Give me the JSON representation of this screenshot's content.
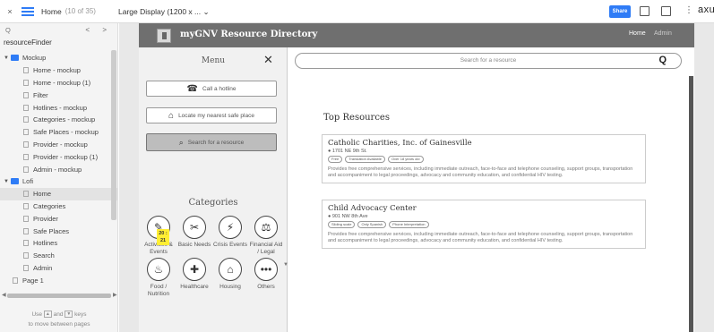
{
  "topbar": {
    "close": "×",
    "page_name": "Home",
    "page_count": "(10 of 35)",
    "device": "Large Display (1200 x ...  ⌄",
    "share": "Share",
    "more": "⋮",
    "brand": "axure"
  },
  "left_panel": {
    "search_placeholder": "Q",
    "nav": "< >",
    "project": "resourceFinder",
    "tree": [
      {
        "type": "folder",
        "label": "Mockup"
      },
      {
        "type": "page",
        "label": "Home - mockup"
      },
      {
        "type": "page",
        "label": "Home - mockup (1)"
      },
      {
        "type": "page",
        "label": "Filter"
      },
      {
        "type": "page",
        "label": "Hotlines - mockup"
      },
      {
        "type": "page",
        "label": "Categories - mockup"
      },
      {
        "type": "page",
        "label": "Safe Places - mockup"
      },
      {
        "type": "page",
        "label": "Provider - mockup"
      },
      {
        "type": "page",
        "label": "Provider - mockup (1)"
      },
      {
        "type": "page",
        "label": "Admin - mockup"
      },
      {
        "type": "folder",
        "label": "Lofi"
      },
      {
        "type": "page",
        "label": "Home",
        "selected": true
      },
      {
        "type": "page",
        "label": "Categories"
      },
      {
        "type": "page",
        "label": "Provider"
      },
      {
        "type": "page",
        "label": "Safe Places"
      },
      {
        "type": "page",
        "label": "Hotlines"
      },
      {
        "type": "page",
        "label": "Search"
      },
      {
        "type": "page",
        "label": "Admin"
      },
      {
        "type": "root",
        "label": "Page 1"
      }
    ],
    "hint_use": "Use",
    "hint_and": "and",
    "hint_keys": "keys",
    "hint_line2": "to move between pages",
    "key_up": "▲",
    "key_down": "▼"
  },
  "app": {
    "title": "myGNV Resource Directory",
    "nav_home": "Home",
    "nav_admin": "Admin",
    "menu": {
      "title": "Menu",
      "close": "✕",
      "buttons": [
        {
          "label": "Call a hotline",
          "icon": "☎"
        },
        {
          "label": "Locate my nearest safe place",
          "icon": "⌂"
        },
        {
          "label": "Search for a resource",
          "icon": "🔍"
        }
      ],
      "categories_title": "Categories",
      "badge": "20 : 21",
      "categories": [
        {
          "label": "Activities & Events",
          "icon": "✎"
        },
        {
          "label": "Basic Needs",
          "icon": "✂"
        },
        {
          "label": "Crisis Events",
          "icon": "⚡"
        },
        {
          "label": "Financial Aid / Legal",
          "icon": "⚖"
        },
        {
          "label": "Food / Nutrition",
          "icon": "♨"
        },
        {
          "label": "Healthcare",
          "icon": "✚"
        },
        {
          "label": "Housing",
          "icon": "⌂"
        },
        {
          "label": "Others",
          "icon": "•••"
        }
      ]
    },
    "search_placeholder": "Search for a resource",
    "search_icon": "magnifier-icon",
    "top_resources_title": "Top Resources",
    "resources": [
      {
        "name": "Catholic Charities, Inc. of Gainesville",
        "address": "1701 NE 9th St.",
        "tags": [
          "Free",
          "Translation Available",
          "Over 18 years old"
        ],
        "description": "Provides free comprehensive services, including immediate outreach, face-to-face and telephone counseling, support groups, transportation and accompaniment to legal proceedings, advocacy and community education, and confidential HIV testing."
      },
      {
        "name": "Child Advocacy Center",
        "address": "901 NW 8th Ave",
        "tags": [
          "Sliding scale",
          "Only Spanish",
          "Phone Interpretation"
        ],
        "description": "Provides free comprehensive services, including immediate outreach, face-to-face and telephone counseling, support groups, transportation and accompaniment to legal proceedings, advocacy and community education, and confidential HIV testing."
      }
    ]
  },
  "colors": {
    "accent": "#2f7cf6",
    "header": "#6f6f6f",
    "menu_bg": "#f1f1f1",
    "badge": "#ffee33"
  }
}
